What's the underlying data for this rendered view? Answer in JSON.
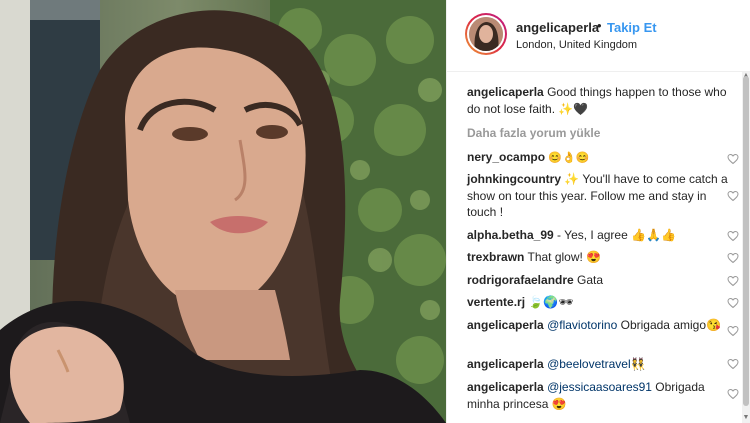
{
  "post": {
    "username": "angelicaperla",
    "dot": "•",
    "follow_label": "Takip Et",
    "location": "London, United Kingdom"
  },
  "caption": {
    "username": "angelicaperla",
    "text": "Good things happen to those who do not lose faith. ✨🖤"
  },
  "load_more": "Daha fazla yorum yükle",
  "comments": [
    {
      "username": "nery_ocampo",
      "text": "😊👌😊"
    },
    {
      "username": "johnkingcountry",
      "text": "✨ You'll have to come catch a show on tour this year. Follow me and stay in touch !"
    },
    {
      "username": "alpha.betha_99",
      "text": "- Yes, I agree 👍🙏👍"
    },
    {
      "username": "trexbrawn",
      "text": "That glow! 😍"
    },
    {
      "username": "rodrigorafaelandre",
      "text": "Gata"
    },
    {
      "username": "vertente.rj",
      "text": "🍃🌍🕶"
    },
    {
      "username": "angelicaperla",
      "mention": "@flaviotorino",
      "text": " Obrigada amigo😘"
    },
    {
      "username": "angelicaperla",
      "mention": "@beelovetravel",
      "text": "👯"
    },
    {
      "username": "angelicaperla",
      "mention": "@jessicaasoares91",
      "text": " Obrigada minha princesa 😍"
    }
  ],
  "icons": {
    "like": "heart-icon",
    "scroll_up": "▲",
    "scroll_down": "▼"
  },
  "colors": {
    "link": "#3897f0",
    "mention": "#003569",
    "muted": "#999999"
  }
}
